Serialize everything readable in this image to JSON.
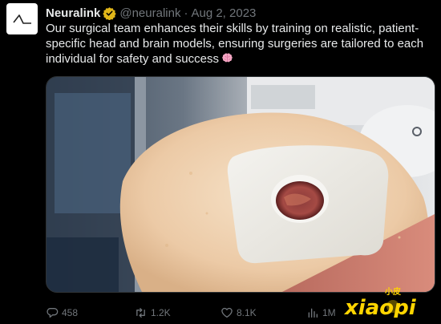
{
  "author": {
    "name": "Neuralink",
    "handle": "@neuralink",
    "separator": "·",
    "date": "Aug 2, 2023",
    "avatar_icon": "neuralink-logo-icon",
    "verified_icon": "verified-badge-icon",
    "verified_color": "#e2b719"
  },
  "tweet": {
    "text": "Our surgical team enhances their skills by training on realistic, patient-specific head and brain models, ensuring surgeries are tailored to each individual for safety and success",
    "emoji_icon": "brain-emoji-icon"
  },
  "media": {
    "type": "photo",
    "subject": "surgical training head model"
  },
  "watermark": {
    "top_text": "小皮",
    "main_text": "xiaopi",
    "brand_color": "#ffd500"
  },
  "actions": {
    "replies": "458",
    "retweets": "1.2K",
    "likes": "8.1K",
    "views": "1M"
  }
}
